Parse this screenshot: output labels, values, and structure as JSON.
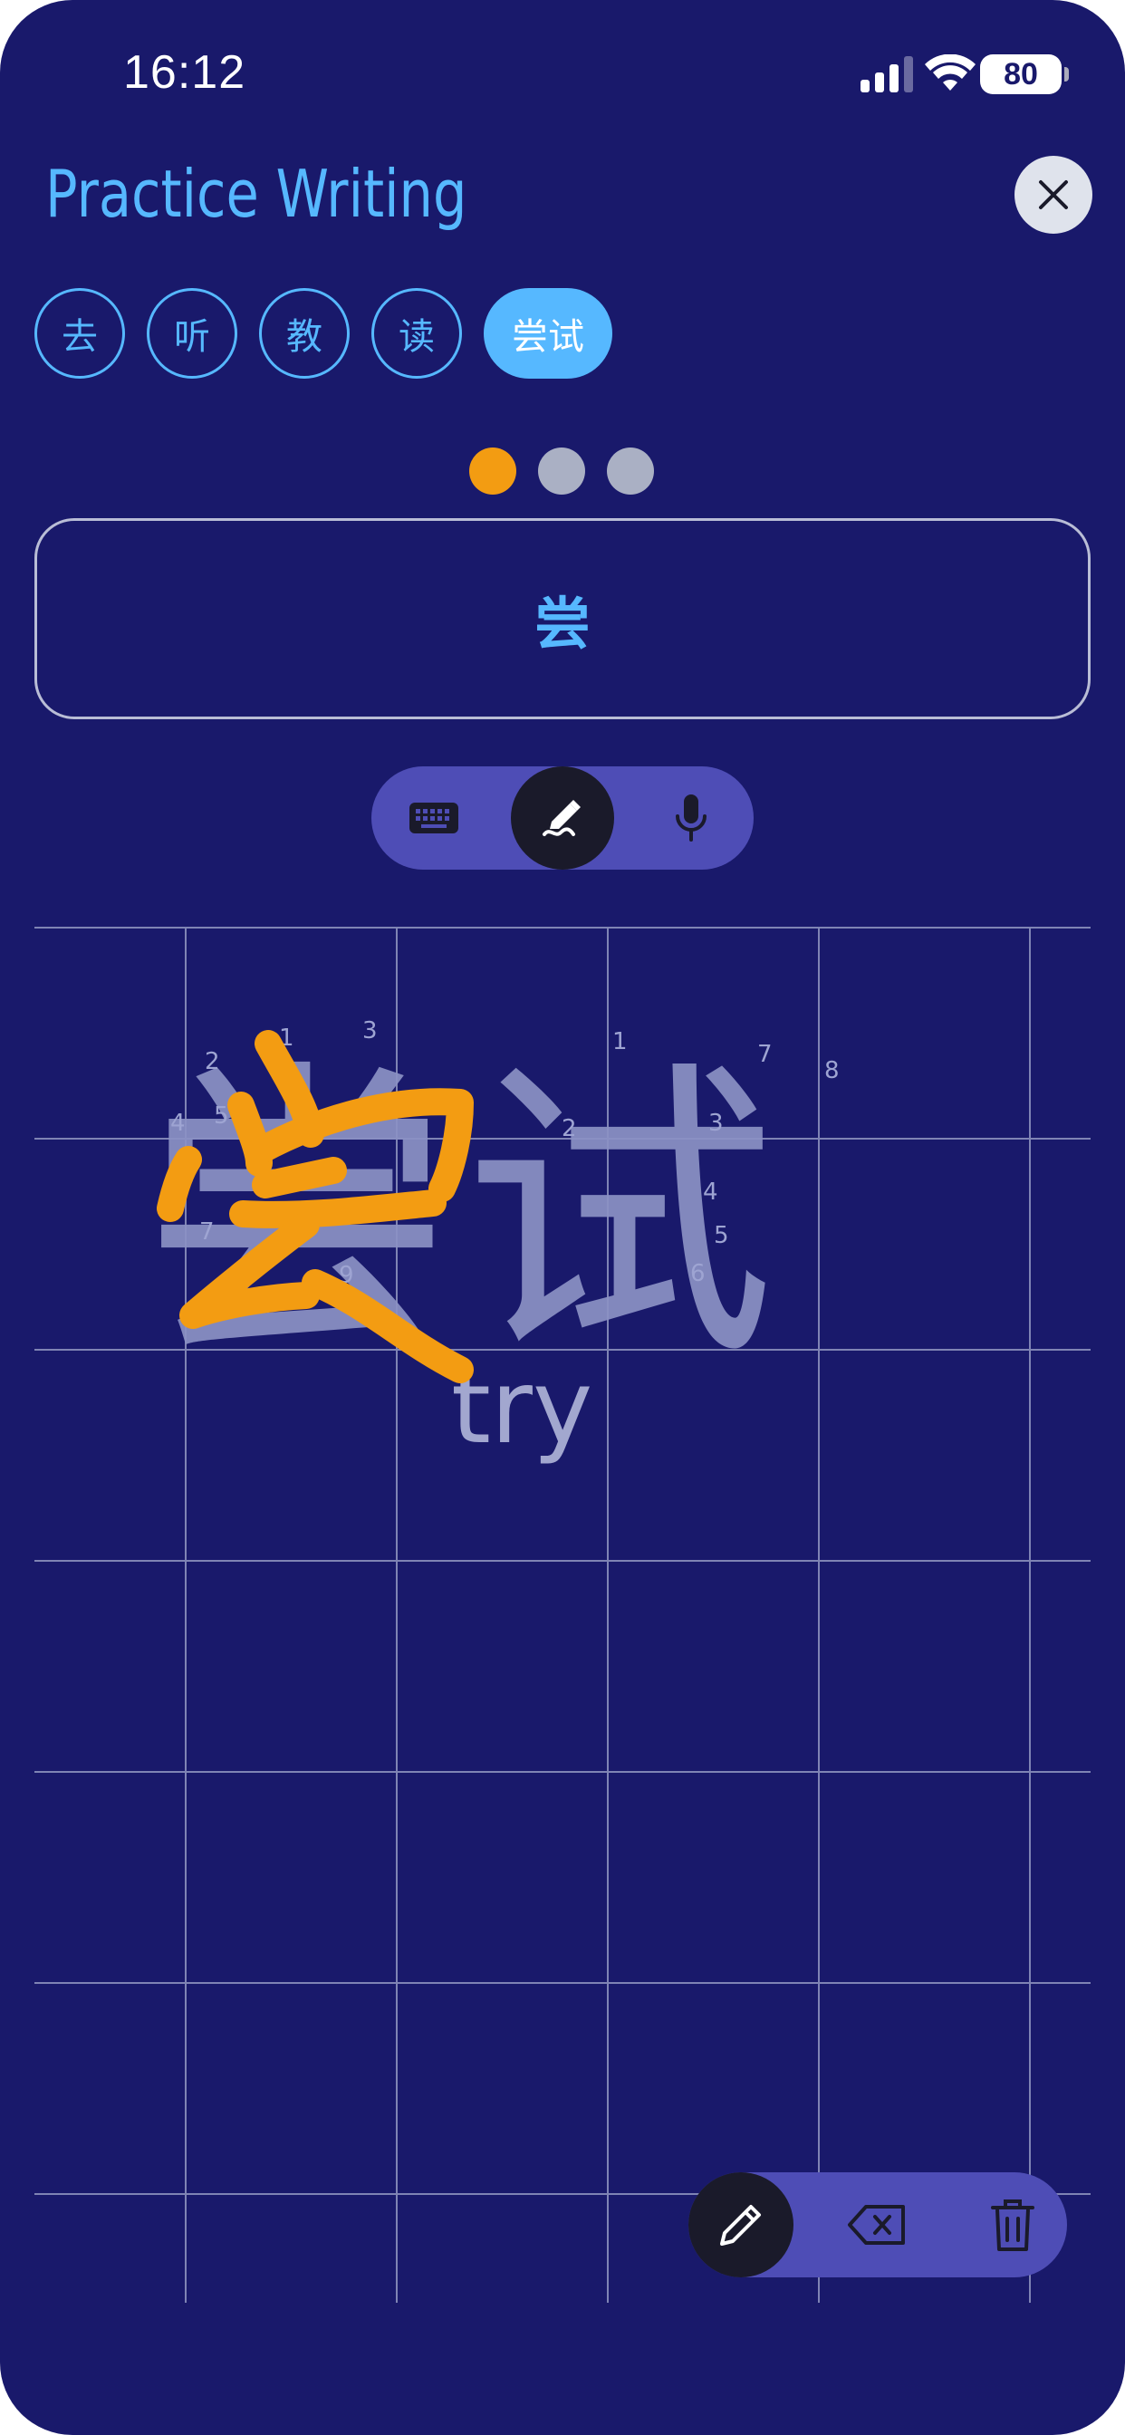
{
  "status_bar": {
    "time": "16:12",
    "battery": "80",
    "icons": [
      "cellular-signal-icon",
      "wifi-icon",
      "battery-icon"
    ]
  },
  "header": {
    "title": "Practice Writing",
    "close_icon": "close-icon"
  },
  "word_chips": [
    {
      "label": "去",
      "active": false
    },
    {
      "label": "听",
      "active": false
    },
    {
      "label": "教",
      "active": false
    },
    {
      "label": "读",
      "active": false
    },
    {
      "label": "尝试",
      "active": true
    }
  ],
  "progress": {
    "total": 3,
    "current": 1
  },
  "prompt": {
    "character": "尝"
  },
  "input_modes": [
    {
      "icon": "keyboard-icon",
      "active": false
    },
    {
      "icon": "handwriting-icon",
      "active": true
    },
    {
      "icon": "microphone-icon",
      "active": false
    }
  ],
  "canvas": {
    "guide_word": "尝试",
    "guide_meaning": "try",
    "stroke_numbers_char1": [
      "1",
      "2",
      "3",
      "4",
      "5",
      "6",
      "7",
      "8",
      "9"
    ],
    "stroke_numbers_char2": [
      "1",
      "2",
      "3",
      "4",
      "5",
      "6",
      "7",
      "8"
    ]
  },
  "drawing_tools": [
    {
      "icon": "pencil-icon",
      "active": true
    },
    {
      "icon": "backspace-icon",
      "active": false
    },
    {
      "icon": "trash-icon",
      "active": false
    }
  ],
  "colors": {
    "background": "#19196b",
    "accent": "#56b8ff",
    "ink": "#f39c12",
    "toolbar": "#4e4db6"
  }
}
